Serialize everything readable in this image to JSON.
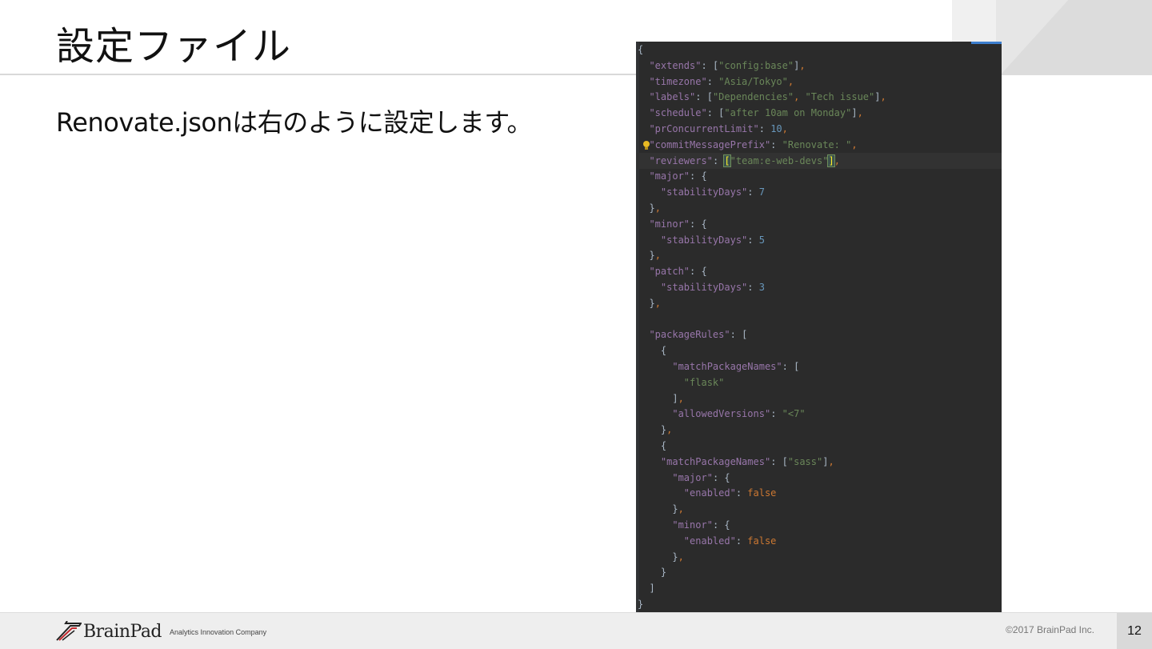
{
  "slide": {
    "title": "設定ファイル",
    "body": "Renovate.jsonは右のように設定します。"
  },
  "code": {
    "lines": [
      [
        [
          "{",
          "p"
        ]
      ],
      [
        [
          "  ",
          "p"
        ],
        [
          "\"extends\"",
          "k"
        ],
        [
          ": ",
          "p"
        ],
        [
          "[",
          "p"
        ],
        [
          "\"config:base\"",
          "s"
        ],
        [
          "]",
          "p"
        ],
        [
          ",",
          "b"
        ]
      ],
      [
        [
          "  ",
          "p"
        ],
        [
          "\"timezone\"",
          "k"
        ],
        [
          ": ",
          "p"
        ],
        [
          "\"Asia/Tokyo\"",
          "s"
        ],
        [
          ",",
          "b"
        ]
      ],
      [
        [
          "  ",
          "p"
        ],
        [
          "\"labels\"",
          "k"
        ],
        [
          ": ",
          "p"
        ],
        [
          "[",
          "p"
        ],
        [
          "\"Dependencies\"",
          "s"
        ],
        [
          ", ",
          "b"
        ],
        [
          "\"Tech issue\"",
          "s"
        ],
        [
          "]",
          "p"
        ],
        [
          ",",
          "b"
        ]
      ],
      [
        [
          "  ",
          "p"
        ],
        [
          "\"schedule\"",
          "k"
        ],
        [
          ": ",
          "p"
        ],
        [
          "[",
          "p"
        ],
        [
          "\"after 10am on Monday\"",
          "s"
        ],
        [
          "]",
          "p"
        ],
        [
          ",",
          "b"
        ]
      ],
      [
        [
          "  ",
          "p"
        ],
        [
          "\"prConcurrentLimit\"",
          "k"
        ],
        [
          ": ",
          "p"
        ],
        [
          "10",
          "n"
        ],
        [
          ",",
          "b"
        ]
      ],
      [
        [
          "  ",
          "p"
        ],
        [
          "\"commitMessagePrefix\"",
          "k"
        ],
        [
          ": ",
          "p"
        ],
        [
          "\"Renovate: \"",
          "s"
        ],
        [
          ",",
          "b"
        ]
      ],
      [
        [
          "  ",
          "p"
        ],
        [
          "\"reviewers\"",
          "k"
        ],
        [
          ": ",
          "p"
        ],
        [
          "[",
          "hl"
        ],
        [
          "\"team:e-web-devs\"",
          "s"
        ],
        [
          "]",
          "hl"
        ],
        [
          ",",
          "b"
        ]
      ],
      [
        [
          "  ",
          "p"
        ],
        [
          "\"major\"",
          "k"
        ],
        [
          ": ",
          "p"
        ],
        [
          "{",
          "p"
        ]
      ],
      [
        [
          "    ",
          "p"
        ],
        [
          "\"stabilityDays\"",
          "k"
        ],
        [
          ": ",
          "p"
        ],
        [
          "7",
          "n"
        ]
      ],
      [
        [
          "  ",
          "p"
        ],
        [
          "}",
          "p"
        ],
        [
          ",",
          "b"
        ]
      ],
      [
        [
          "  ",
          "p"
        ],
        [
          "\"minor\"",
          "k"
        ],
        [
          ": ",
          "p"
        ],
        [
          "{",
          "p"
        ]
      ],
      [
        [
          "    ",
          "p"
        ],
        [
          "\"stabilityDays\"",
          "k"
        ],
        [
          ": ",
          "p"
        ],
        [
          "5",
          "n"
        ]
      ],
      [
        [
          "  ",
          "p"
        ],
        [
          "}",
          "p"
        ],
        [
          ",",
          "b"
        ]
      ],
      [
        [
          "  ",
          "p"
        ],
        [
          "\"patch\"",
          "k"
        ],
        [
          ": ",
          "p"
        ],
        [
          "{",
          "p"
        ]
      ],
      [
        [
          "    ",
          "p"
        ],
        [
          "\"stabilityDays\"",
          "k"
        ],
        [
          ": ",
          "p"
        ],
        [
          "3",
          "n"
        ]
      ],
      [
        [
          "  ",
          "p"
        ],
        [
          "}",
          "p"
        ],
        [
          ",",
          "b"
        ]
      ],
      [
        [
          "",
          "p"
        ]
      ],
      [
        [
          "  ",
          "p"
        ],
        [
          "\"packageRules\"",
          "k"
        ],
        [
          ": ",
          "p"
        ],
        [
          "[",
          "p"
        ]
      ],
      [
        [
          "    ",
          "p"
        ],
        [
          "{",
          "p"
        ]
      ],
      [
        [
          "      ",
          "p"
        ],
        [
          "\"matchPackageNames\"",
          "k"
        ],
        [
          ": ",
          "p"
        ],
        [
          "[",
          "p"
        ]
      ],
      [
        [
          "        ",
          "p"
        ],
        [
          "\"flask\"",
          "s"
        ]
      ],
      [
        [
          "      ",
          "p"
        ],
        [
          "]",
          "p"
        ],
        [
          ",",
          "b"
        ]
      ],
      [
        [
          "      ",
          "p"
        ],
        [
          "\"allowedVersions\"",
          "k"
        ],
        [
          ": ",
          "p"
        ],
        [
          "\"<7\"",
          "s"
        ]
      ],
      [
        [
          "    ",
          "p"
        ],
        [
          "}",
          "p"
        ],
        [
          ",",
          "b"
        ]
      ],
      [
        [
          "    ",
          "p"
        ],
        [
          "{",
          "p"
        ]
      ],
      [
        [
          "    ",
          "p"
        ],
        [
          "\"matchPackageNames\"",
          "k"
        ],
        [
          ": ",
          "p"
        ],
        [
          "[",
          "p"
        ],
        [
          "\"sass\"",
          "s"
        ],
        [
          "]",
          "p"
        ],
        [
          ",",
          "b"
        ]
      ],
      [
        [
          "      ",
          "p"
        ],
        [
          "\"major\"",
          "k"
        ],
        [
          ": ",
          "p"
        ],
        [
          "{",
          "p"
        ]
      ],
      [
        [
          "        ",
          "p"
        ],
        [
          "\"enabled\"",
          "k"
        ],
        [
          ": ",
          "p"
        ],
        [
          "false",
          "b"
        ]
      ],
      [
        [
          "      ",
          "p"
        ],
        [
          "}",
          "p"
        ],
        [
          ",",
          "b"
        ]
      ],
      [
        [
          "      ",
          "p"
        ],
        [
          "\"minor\"",
          "k"
        ],
        [
          ": ",
          "p"
        ],
        [
          "{",
          "p"
        ]
      ],
      [
        [
          "        ",
          "p"
        ],
        [
          "\"enabled\"",
          "k"
        ],
        [
          ": ",
          "p"
        ],
        [
          "false",
          "b"
        ]
      ],
      [
        [
          "      ",
          "p"
        ],
        [
          "}",
          "p"
        ],
        [
          ",",
          "b"
        ]
      ],
      [
        [
          "    ",
          "p"
        ],
        [
          "}",
          "p"
        ]
      ],
      [
        [
          "  ",
          "p"
        ],
        [
          "]",
          "p"
        ]
      ],
      [
        [
          "}",
          "p"
        ]
      ]
    ],
    "current_line": 7,
    "bulb_line": 6
  },
  "footer": {
    "logo_text": "BrainPad",
    "tagline": "Analytics Innovation Company",
    "copyright": "©2017 BrainPad Inc.",
    "page_number": "12"
  },
  "colors": {
    "editor_bg": "#2b2b2b",
    "json_key": "#9876aa",
    "json_string": "#6a8759",
    "json_number": "#6897bb",
    "json_keyword": "#cc7832",
    "footer_bg": "#eeeeee"
  }
}
